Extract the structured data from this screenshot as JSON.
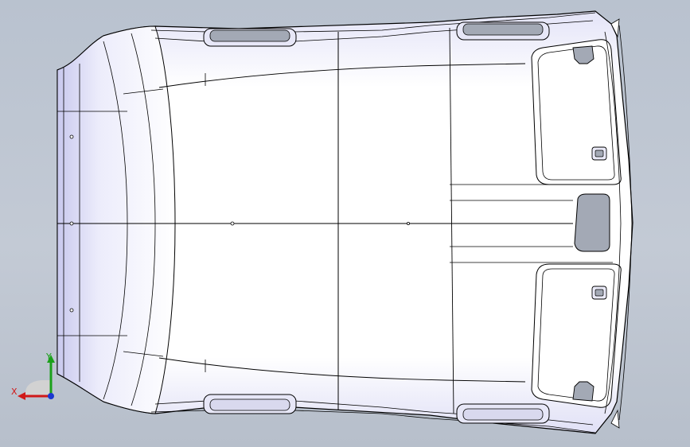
{
  "viewport": {
    "background_top": "#b9c2cf",
    "background_bottom": "#b7bfcb"
  },
  "colors": {
    "edge": "#000000",
    "face_light": "#ffffff",
    "face_shade": "#d7d7f2",
    "cutout": "#a3a9b5",
    "axis_x": "#d01818",
    "axis_y": "#1aa01a",
    "axis_z": "#1a38d0"
  },
  "triad": {
    "x_label": "X",
    "y_label": "Y",
    "x_icon": "x-axis-arrow-icon",
    "y_icon": "y-axis-arrow-icon",
    "z_icon": "z-axis-dot-icon"
  }
}
